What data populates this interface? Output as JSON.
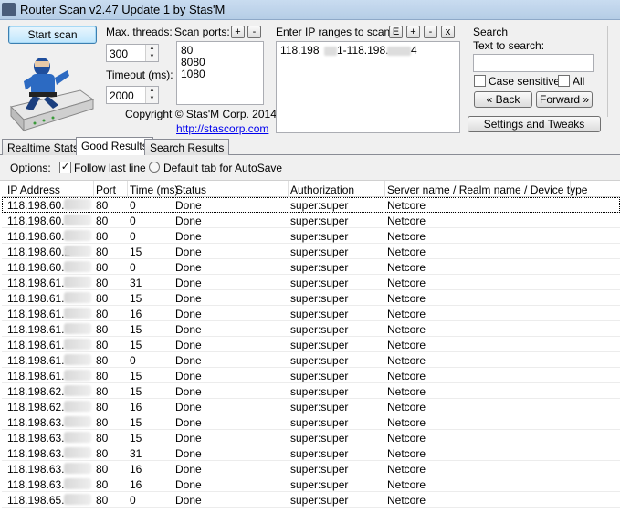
{
  "window": {
    "title": "Router Scan v2.47 Update 1 by Stas'M"
  },
  "controls": {
    "start_scan": "Start scan",
    "max_threads_label": "Max. threads:",
    "max_threads_value": "300",
    "timeout_label": "Timeout (ms):",
    "timeout_value": "2000",
    "scan_ports_label": "Scan ports:",
    "ports": [
      "80",
      "8080",
      "1080"
    ],
    "ip_ranges_label": "Enter IP ranges to scan:",
    "ip_range_start": "118.198",
    "ip_range_sep": "1-118.198.",
    "ip_range_end": "4",
    "copyright": "Copyright © Stas'M Corp. 2014",
    "website": "http://stascorp.com",
    "btn_plus": "+",
    "btn_minus": "-",
    "btn_e": "E",
    "btn_x": "x"
  },
  "search": {
    "group_label": "Search",
    "text_label": "Text to search:",
    "case_sensitive": "Case sensitive",
    "all": "All",
    "back": "« Back",
    "forward": "Forward »",
    "settings": "Settings and Tweaks"
  },
  "tabs": [
    "Realtime Stats",
    "Good Results",
    "Search Results"
  ],
  "options": {
    "label": "Options:",
    "follow_last_line": "Follow last line",
    "default_tab": "Default tab for AutoSave"
  },
  "table": {
    "columns": [
      "IP Address",
      "Port",
      "Time (ms)",
      "Status",
      "Authorization",
      "Server name / Realm name / Device type"
    ],
    "rows": [
      {
        "ip": "118.198.60.",
        "port": "80",
        "time": "0",
        "status": "Done",
        "auth": "super:super",
        "server": "Netcore"
      },
      {
        "ip": "118.198.60.",
        "port": "80",
        "time": "0",
        "status": "Done",
        "auth": "super:super",
        "server": "Netcore"
      },
      {
        "ip": "118.198.60.",
        "port": "80",
        "time": "0",
        "status": "Done",
        "auth": "super:super",
        "server": "Netcore"
      },
      {
        "ip": "118.198.60.2",
        "port": "80",
        "time": "15",
        "status": "Done",
        "auth": "super:super",
        "server": "Netcore"
      },
      {
        "ip": "118.198.60.",
        "port": "80",
        "time": "0",
        "status": "Done",
        "auth": "super:super",
        "server": "Netcore"
      },
      {
        "ip": "118.198.61.",
        "port": "80",
        "time": "31",
        "status": "Done",
        "auth": "super:super",
        "server": "Netcore"
      },
      {
        "ip": "118.198.61.",
        "port": "80",
        "time": "15",
        "status": "Done",
        "auth": "super:super",
        "server": "Netcore"
      },
      {
        "ip": "118.198.61.",
        "port": "80",
        "time": "16",
        "status": "Done",
        "auth": "super:super",
        "server": "Netcore"
      },
      {
        "ip": "118.198.61.",
        "port": "80",
        "time": "15",
        "status": "Done",
        "auth": "super:super",
        "server": "Netcore"
      },
      {
        "ip": "118.198.61.",
        "port": "80",
        "time": "15",
        "status": "Done",
        "auth": "super:super",
        "server": "Netcore"
      },
      {
        "ip": "118.198.61.",
        "port": "80",
        "time": "0",
        "status": "Done",
        "auth": "super:super",
        "server": "Netcore"
      },
      {
        "ip": "118.198.61.",
        "port": "80",
        "time": "15",
        "status": "Done",
        "auth": "super:super",
        "server": "Netcore"
      },
      {
        "ip": "118.198.62.",
        "port": "80",
        "time": "15",
        "status": "Done",
        "auth": "super:super",
        "server": "Netcore"
      },
      {
        "ip": "118.198.62.",
        "port": "80",
        "time": "16",
        "status": "Done",
        "auth": "super:super",
        "server": "Netcore"
      },
      {
        "ip": "118.198.63.",
        "port": "80",
        "time": "15",
        "status": "Done",
        "auth": "super:super",
        "server": "Netcore"
      },
      {
        "ip": "118.198.63.",
        "port": "80",
        "time": "15",
        "status": "Done",
        "auth": "super:super",
        "server": "Netcore"
      },
      {
        "ip": "118.198.63.",
        "port": "80",
        "time": "31",
        "status": "Done",
        "auth": "super:super",
        "server": "Netcore"
      },
      {
        "ip": "118.198.63.",
        "port": "80",
        "time": "16",
        "status": "Done",
        "auth": "super:super",
        "server": "Netcore"
      },
      {
        "ip": "118.198.63.",
        "port": "80",
        "time": "16",
        "status": "Done",
        "auth": "super:super",
        "server": "Netcore"
      },
      {
        "ip": "118.198.65.",
        "port": "80",
        "time": "0",
        "status": "Done",
        "auth": "super:super",
        "server": "Netcore"
      }
    ]
  }
}
